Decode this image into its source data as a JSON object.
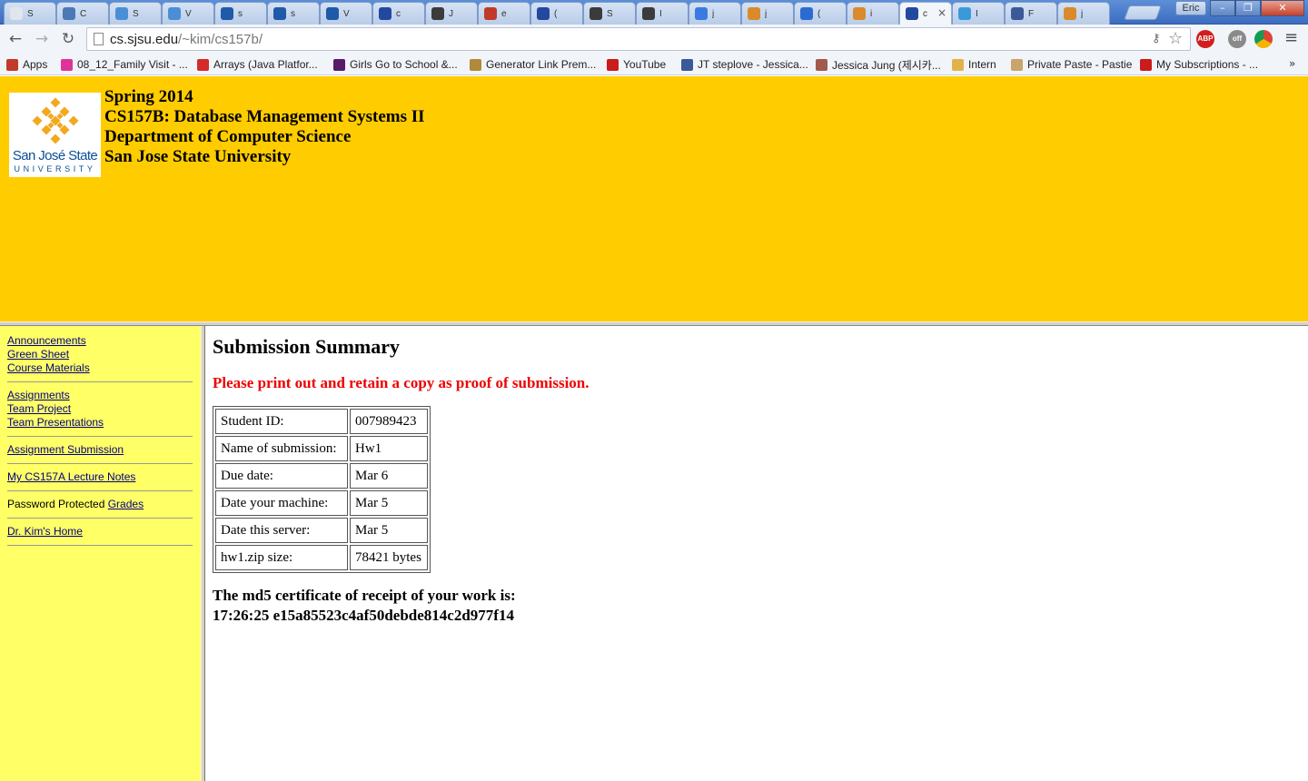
{
  "browser": {
    "tabs": [
      {
        "title": "S",
        "icon": "page-icon",
        "color": "#dfe6ee"
      },
      {
        "title": "C",
        "icon": "p-icon",
        "color": "#4a79b5"
      },
      {
        "title": "S",
        "icon": "sd-icon",
        "color": "#4a8fd6"
      },
      {
        "title": "V",
        "icon": "sd-icon",
        "color": "#4a8fd6"
      },
      {
        "title": "s",
        "icon": "wd-icon",
        "color": "#1e5aa8"
      },
      {
        "title": "s",
        "icon": "wd-icon",
        "color": "#1e5aa8"
      },
      {
        "title": "V",
        "icon": "wd-icon",
        "color": "#1e5aa8"
      },
      {
        "title": "c",
        "icon": "sjsu-icon",
        "color": "#2348a0"
      },
      {
        "title": "J",
        "icon": "cube-icon",
        "color": "#3b3b3b"
      },
      {
        "title": "e",
        "icon": "flower-icon",
        "color": "#c0392b"
      },
      {
        "title": "(",
        "icon": "sjsu-icon",
        "color": "#2348a0"
      },
      {
        "title": "S",
        "icon": "cube-icon",
        "color": "#3b3b3b"
      },
      {
        "title": "I",
        "icon": "cube-icon",
        "color": "#3b3b3b"
      },
      {
        "title": "j",
        "icon": "google-icon",
        "color": "#3a7ae0"
      },
      {
        "title": "j",
        "icon": "stack-icon",
        "color": "#d98a2a"
      },
      {
        "title": "(",
        "icon": "loading-icon",
        "color": "#2b6bd1"
      },
      {
        "title": "i",
        "icon": "stack-icon",
        "color": "#d98a2a"
      },
      {
        "title": "c",
        "icon": "sjsu-icon",
        "color": "#2348a0",
        "active": true,
        "close": "×"
      },
      {
        "title": "I",
        "icon": "cloud-icon",
        "color": "#3a9ad9"
      },
      {
        "title": "F",
        "icon": "facebook-icon",
        "color": "#3b5998"
      },
      {
        "title": "j",
        "icon": "stack-icon",
        "color": "#d98a2a"
      }
    ],
    "profile": "Eric",
    "window_controls": {
      "minimize": "–",
      "maximize": "❐",
      "close": "✕"
    },
    "nav": {
      "back": "←",
      "forward": "→",
      "reload": "↻"
    },
    "url_host": "cs.sjsu.edu",
    "url_path": "/~kim/cs157b/",
    "extensions": {
      "abp": "ABP",
      "ghost": "off",
      "chrome": ""
    },
    "menu_glyph": "≡",
    "star_glyph": "☆",
    "key_glyph": "⚷",
    "bookmarks": [
      {
        "label": "Apps",
        "icon": "apps-icon",
        "color": "#c23a2a"
      },
      {
        "label": "08_12_Family Visit - ...",
        "icon": "flickr-icon",
        "color": "#e0339a"
      },
      {
        "label": "Arrays (Java Platfor...",
        "icon": "oracle-icon",
        "color": "#d42a2a"
      },
      {
        "label": "Girls Go to School &...",
        "icon": "sgs-icon",
        "color": "#5a1a6a"
      },
      {
        "label": "Generator Link Prem...",
        "icon": "link-icon",
        "color": "#b08a3a"
      },
      {
        "label": "YouTube",
        "icon": "youtube-icon",
        "color": "#cc1b1b"
      },
      {
        "label": "JT steplove - Jessica...",
        "icon": "facebook-icon",
        "color": "#3b5998"
      },
      {
        "label": "Jessica Jung (제시카...",
        "icon": "avatar-icon",
        "color": "#a35a4a"
      },
      {
        "label": "Intern",
        "icon": "folder-icon",
        "color": "#e2b24a"
      },
      {
        "label": "Private Paste - Pastie",
        "icon": "pastie-icon",
        "color": "#c9a46b"
      },
      {
        "label": "My Subscriptions - ...",
        "icon": "youtube-icon",
        "color": "#cc1b1b"
      }
    ],
    "bookmarks_more": "»"
  },
  "header": {
    "logo_name": "San José State",
    "logo_univ": "UNIVERSITY",
    "lines": [
      "Spring 2014",
      "CS157B: Database Management Systems II",
      "Department of Computer Science",
      "San Jose State University"
    ],
    "accent": "#ffcc00",
    "logo_gold": "#f3a81e",
    "logo_blue": "#0b4f98"
  },
  "sidebar": {
    "groups": [
      {
        "links": [
          "Announcements",
          "Green Sheet",
          "Course Materials"
        ]
      },
      {
        "links": [
          "Assignments ",
          "Team Project ",
          "Team Presentations "
        ]
      },
      {
        "links": [
          "Assignment Submission "
        ]
      },
      {
        "links": [
          "My CS157A Lecture Notes"
        ]
      },
      {
        "text": "Password Protected ",
        "link": "Grades"
      },
      {
        "links": [
          "Dr. Kim's Home"
        ]
      }
    ],
    "background": "#ffff66"
  },
  "main": {
    "title": "Submission Summary",
    "notice": "Please print out and retain a copy as proof of submission.",
    "notice_color": "#ee0000",
    "rows": [
      {
        "label": "Student ID:",
        "value": "007989423"
      },
      {
        "label": "Name of submission:",
        "value": "Hw1"
      },
      {
        "label": "Due date:",
        "value": "Mar 6"
      },
      {
        "label": "Date your machine:",
        "value": "Mar 5"
      },
      {
        "label": "Date this server:",
        "value": "Mar 5"
      },
      {
        "label": "hw1.zip size:",
        "value": "78421 bytes"
      }
    ],
    "md5_label": "The md5 certificate of receipt of your work is:",
    "md5_value": "17:26:25 e15a85523c4af50debde814c2d977f14"
  }
}
